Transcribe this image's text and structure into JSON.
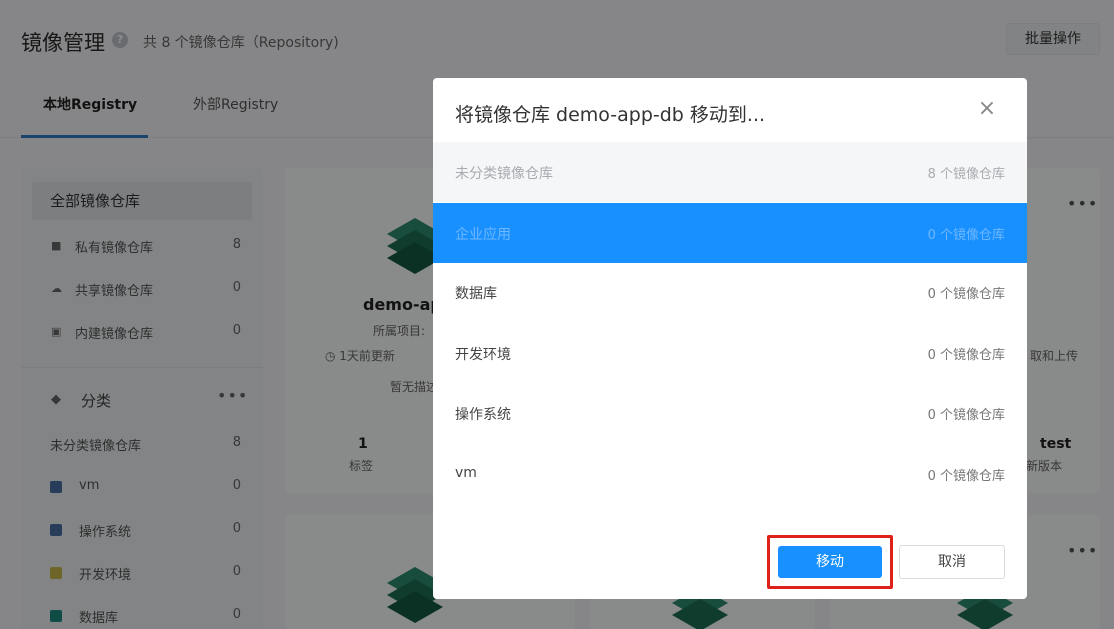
{
  "header": {
    "title": "镜像管理",
    "repo_count": "共 8 个镜像仓库（Repository)",
    "batch_button": "批量操作"
  },
  "tabs": [
    {
      "label": "本地Registry",
      "active": true
    },
    {
      "label": "外部Registry",
      "active": false
    }
  ],
  "sidebar": {
    "all_label": "全部镜像仓库",
    "items": [
      {
        "label": "私有镜像仓库",
        "count": "8",
        "icon": "lock-icon"
      },
      {
        "label": "共享镜像仓库",
        "count": "0",
        "icon": "cloud-icon"
      },
      {
        "label": "内建镜像仓库",
        "count": "0",
        "icon": "copy-icon"
      }
    ],
    "category_header": "分类",
    "categories": [
      {
        "label": "未分类镜像仓库",
        "count": "8",
        "color": ""
      },
      {
        "label": "vm",
        "count": "0",
        "color": "#4a6fa5"
      },
      {
        "label": "操作系统",
        "count": "0",
        "color": "#4a6fa5"
      },
      {
        "label": "开发环境",
        "count": "0",
        "color": "#c8b84a"
      },
      {
        "label": "数据库",
        "count": "0",
        "color": "#1e8a80"
      }
    ]
  },
  "card": {
    "name": "demo-ap",
    "project": "所属项目:",
    "updated": "1天前更新",
    "desc": "暂无描述",
    "tags_count": "1",
    "tags_label": "标签",
    "right_meta": "取和上传",
    "right_version": "test",
    "right_version_label": "新版本"
  },
  "modal": {
    "title": "将镜像仓库 demo-app-db 移动到...",
    "options": [
      {
        "label": "未分类镜像仓库",
        "count": "8 个镜像仓库",
        "state": "disabled"
      },
      {
        "label": "企业应用",
        "count": "0 个镜像仓库",
        "state": "selected"
      },
      {
        "label": "数据库",
        "count": "0 个镜像仓库",
        "state": "normal"
      },
      {
        "label": "开发环境",
        "count": "0 个镜像仓库",
        "state": "normal"
      },
      {
        "label": "操作系统",
        "count": "0 个镜像仓库",
        "state": "normal"
      },
      {
        "label": "vm",
        "count": "0 个镜像仓库",
        "state": "normal"
      }
    ],
    "move_button": "移动",
    "cancel_button": "取消"
  },
  "colors": {
    "primary": "#1890ff",
    "highlight": "#e0201a",
    "layer_icon": "#1a5f4a"
  }
}
